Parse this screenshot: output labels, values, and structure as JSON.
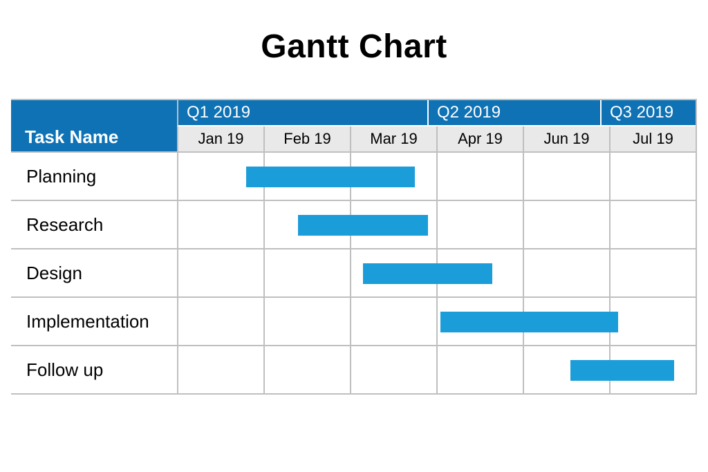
{
  "title": "Gantt Chart",
  "header_label": "Task Name",
  "colors": {
    "header_blue": "#0e72b5",
    "bar_blue": "#1b9dd9",
    "month_bg": "#e9e9e9"
  },
  "quarters": [
    {
      "label": "Q1 2019",
      "span": 3
    },
    {
      "label": "Q2 2019",
      "span": 2
    },
    {
      "label": "Q3 2019",
      "span": 1
    }
  ],
  "months": [
    "Jan 19",
    "Feb 19",
    "Mar 19",
    "Apr 19",
    "Jun 19",
    "Jul 19"
  ],
  "tasks": [
    {
      "name": "Planning",
      "start": 0.8,
      "end": 2.75
    },
    {
      "name": "Research",
      "start": 1.4,
      "end": 2.9
    },
    {
      "name": "Design",
      "start": 2.15,
      "end": 3.65
    },
    {
      "name": "Implementation",
      "start": 3.05,
      "end": 5.1
    },
    {
      "name": "Follow up",
      "start": 4.55,
      "end": 5.75
    }
  ],
  "chart_data": {
    "type": "bar",
    "title": "Gantt Chart",
    "xlabel": "",
    "ylabel": "Task Name",
    "x_categories": [
      "Jan 19",
      "Feb 19",
      "Mar 19",
      "Apr 19",
      "Jun 19",
      "Jul 19"
    ],
    "x_groups": [
      {
        "label": "Q1 2019",
        "months": [
          "Jan 19",
          "Feb 19",
          "Mar 19"
        ]
      },
      {
        "label": "Q2 2019",
        "months": [
          "Apr 19",
          "Jun 19"
        ]
      },
      {
        "label": "Q3 2019",
        "months": [
          "Jul 19"
        ]
      }
    ],
    "tasks": [
      {
        "name": "Planning",
        "start_month_index": 0.8,
        "end_month_index": 2.75
      },
      {
        "name": "Research",
        "start_month_index": 1.4,
        "end_month_index": 2.9
      },
      {
        "name": "Design",
        "start_month_index": 2.15,
        "end_month_index": 3.65
      },
      {
        "name": "Implementation",
        "start_month_index": 3.05,
        "end_month_index": 5.1
      },
      {
        "name": "Follow up",
        "start_month_index": 4.55,
        "end_month_index": 5.75
      }
    ],
    "xlim": [
      0,
      6
    ]
  }
}
